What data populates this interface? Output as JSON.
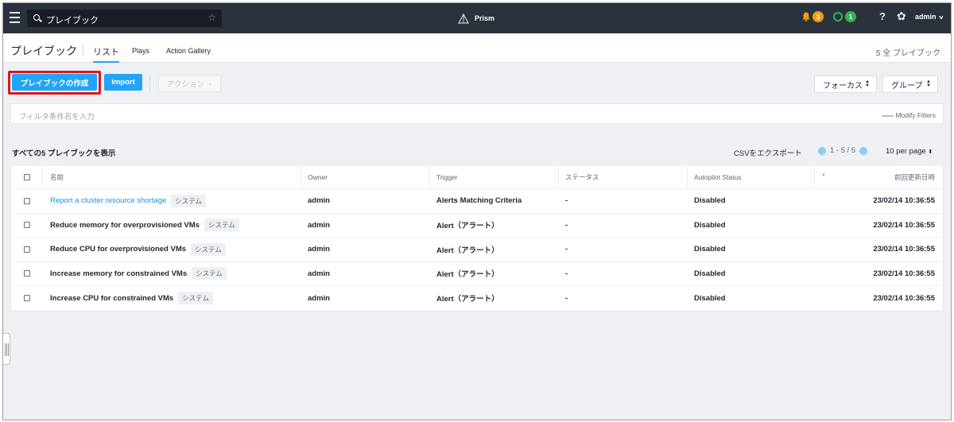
{
  "topbar": {
    "search_value": "プレイブック",
    "brand": "Prism",
    "alerts_count": "3",
    "alerts_color": "#f39c12",
    "tasks_count": "1",
    "tasks_color": "#2fb353",
    "user": "admin",
    "icons": [
      "menu-icon",
      "search-icon",
      "star-icon",
      "prism-logo-icon",
      "bell-icon",
      "task-ring-icon",
      "help-icon",
      "gear-icon"
    ]
  },
  "header": {
    "title": "プレイブック",
    "tabs": [
      {
        "label": "リスト",
        "active": true
      },
      {
        "label": "Plays",
        "active": false
      },
      {
        "label": "Action Gallery",
        "active": false
      }
    ],
    "count_label": "5 全 プレイブック"
  },
  "toolbar": {
    "create_label": "プレイブックの作成",
    "import_label": "Import",
    "actions_label": "アクション",
    "focus_label": "フォーカス",
    "group_label": "グループ",
    "accent": "#22a5f7",
    "highlight": "#e0161b"
  },
  "filter": {
    "placeholder": "フィルタ条件名を入力",
    "modify_label": "Modify Filters"
  },
  "table": {
    "summary": "すべての5 プレイブックを表示",
    "csv_label": "CSVをエクスポート",
    "range": "1 - 5 / 5",
    "per_page": "10 per page",
    "columns": [
      "名前",
      "Owner",
      "Trigger",
      "ステータス",
      "Autopilot Status",
      "前回更新日時"
    ],
    "rows": [
      {
        "name": "Report a cluster resource shortage",
        "tag": "システム",
        "owner": "admin",
        "trigger": "Alerts Matching Criteria",
        "status": "-",
        "autopilot": "Disabled",
        "updated": "23/02/14 10:36:55"
      },
      {
        "name": "Reduce memory for overprovisioned VMs",
        "tag": "システム",
        "owner": "admin",
        "trigger": "Alert（アラート）",
        "status": "-",
        "autopilot": "Disabled",
        "updated": "23/02/14 10:36:55"
      },
      {
        "name": "Reduce CPU for overprovisioned VMs",
        "tag": "システム",
        "owner": "admin",
        "trigger": "Alert（アラート）",
        "status": "-",
        "autopilot": "Disabled",
        "updated": "23/02/14 10:36:55"
      },
      {
        "name": "Increase memory for constrained VMs",
        "tag": "システム",
        "owner": "admin",
        "trigger": "Alert（アラート）",
        "status": "-",
        "autopilot": "Disabled",
        "updated": "23/02/14 10:36:55"
      },
      {
        "name": "Increase CPU for constrained VMs",
        "tag": "システム",
        "owner": "admin",
        "trigger": "Alert（アラート）",
        "status": "-",
        "autopilot": "Disabled",
        "updated": "23/02/14 10:36:55"
      }
    ]
  }
}
